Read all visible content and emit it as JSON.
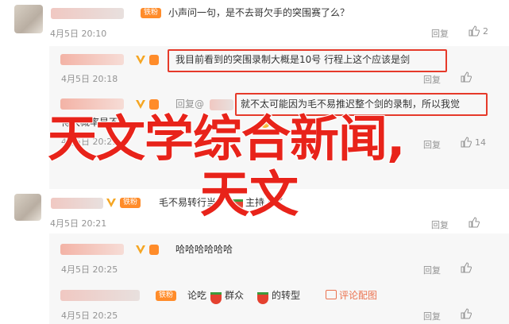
{
  "comments": [
    {
      "badge_text": "铁粉",
      "badge_level": "",
      "text": "小声问一句，是不去哥欠手的突围赛了么？",
      "time": "4月5日 20:10",
      "reply_label": "回复",
      "likes": "2"
    },
    {
      "text": "我目前看到的突围录制大概是10号 行程上这个应该是剑",
      "time": "4月5日 20:18",
      "reply_label": "回复",
      "likes": ""
    },
    {
      "reply_prefix": "回复@",
      "text": "就不太可能因为毛不易推迟整个剑的录制，所以我觉",
      "second_line": "得大概率是不",
      "time": "4月5日 20:21",
      "reply_label": "回复",
      "likes": "14"
    },
    {
      "badge_text": "铁粉",
      "text": "毛不易转行当",
      "text_after_emoji": "主持人了",
      "time": "4月5日 20:21",
      "reply_label": "回复",
      "likes": ""
    },
    {
      "text": "哈哈哈哈哈哈",
      "time": "4月5日 20:25",
      "reply_label": "回复",
      "likes": ""
    },
    {
      "badge_text": "铁粉",
      "text_a": "论吃",
      "text_b": "群众",
      "text_c": "的转型",
      "comment_link": "评论配图",
      "time": "4月5日 20:25",
      "reply_label": "回复",
      "likes": ""
    }
  ],
  "overlay": {
    "line1": "天文学综合新闻,",
    "line2": "天文"
  },
  "colors": {
    "accent_red": "#e63a2a",
    "overlay_red": "#e8231a",
    "fan_badge": "#ff8c2a",
    "meta_gray": "#939393"
  },
  "icons": [
    "thumb-up-icon",
    "vip-v-icon",
    "watermelon-emoji-icon",
    "comment-image-icon"
  ]
}
